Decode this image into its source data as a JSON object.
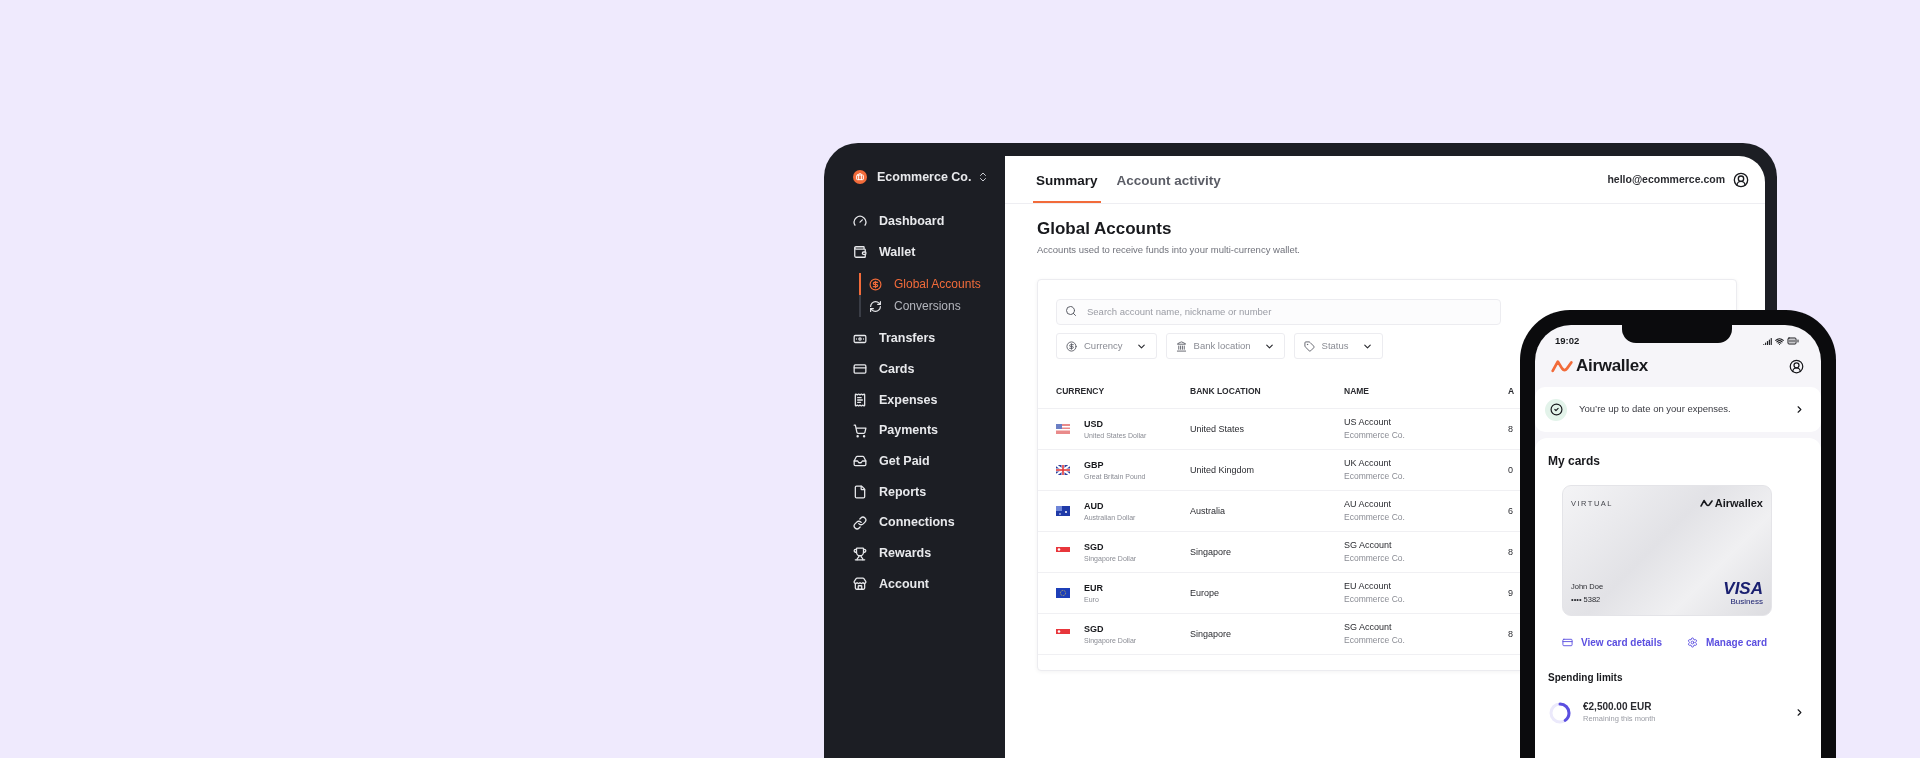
{
  "sidebar": {
    "company": "Ecommerce Co.",
    "items": [
      {
        "label": "Dashboard",
        "selected": false
      },
      {
        "label": "Wallet",
        "selected": false,
        "children": [
          {
            "label": "Global Accounts",
            "selected": true
          },
          {
            "label": "Conversions",
            "selected": false
          }
        ]
      },
      {
        "label": "Transfers",
        "selected": false
      },
      {
        "label": "Cards",
        "selected": false
      },
      {
        "label": "Expenses",
        "selected": false
      },
      {
        "label": "Payments",
        "selected": false
      },
      {
        "label": "Get Paid",
        "selected": false
      },
      {
        "label": "Reports",
        "selected": false
      },
      {
        "label": "Connections",
        "selected": false
      },
      {
        "label": "Rewards",
        "selected": false
      },
      {
        "label": "Account",
        "selected": false
      }
    ]
  },
  "tabs": [
    {
      "label": "Summary",
      "selected": true
    },
    {
      "label": "Account activity",
      "selected": false
    }
  ],
  "user_email": "hello@ecommerce.com",
  "page": {
    "title": "Global Accounts",
    "subtitle": "Accounts used to receive funds into your multi-currency wallet."
  },
  "search": {
    "placeholder": "Search account name, nickname or number"
  },
  "filters": [
    "Currency",
    "Bank location",
    "Status"
  ],
  "table": {
    "columns": [
      "CURRENCY",
      "BANK LOCATION",
      "NAME",
      "A"
    ],
    "rows": [
      {
        "code": "USD",
        "currency": "United States Dollar",
        "location": "United States",
        "name": "US Account",
        "owner": "Ecommerce Co.",
        "column_4": "8"
      },
      {
        "code": "GBP",
        "currency": "Great Britain Pound",
        "location": "United Kingdom",
        "name": "UK Account",
        "owner": "Ecommerce Co.",
        "column_4": "0"
      },
      {
        "code": "AUD",
        "currency": "Australian Dollar",
        "location": "Australia",
        "name": "AU Account",
        "owner": "Ecommerce Co.",
        "column_4": "6"
      },
      {
        "code": "SGD",
        "currency": "Singapore Dollar",
        "location": "Singapore",
        "name": "SG Account",
        "owner": "Ecommerce Co.",
        "column_4": "8"
      },
      {
        "code": "EUR",
        "currency": "Euro",
        "location": "Europe",
        "name": "EU Account",
        "owner": "Ecommerce Co.",
        "column_4": "9"
      },
      {
        "code": "SGD",
        "currency": "Singapore Dollar",
        "location": "Singapore",
        "name": "SG Account",
        "owner": "Ecommerce Co.",
        "column_4": "8"
      }
    ]
  },
  "phone": {
    "time": "19:02",
    "brand": "Airwallex",
    "notice": "You’re up to date on your expenses.",
    "cards_title": "My cards",
    "card": {
      "type": "VIRTUAL",
      "brand": "Airwallex",
      "holder": "John Doe",
      "number": "•••• 5382",
      "network": "VISA",
      "tier": "Business"
    },
    "actions": [
      "View card details",
      "Manage card"
    ],
    "limits_title": "Spending limits",
    "limit": {
      "amount": "€2,500.00 EUR",
      "caption": "Remaining this month"
    }
  }
}
